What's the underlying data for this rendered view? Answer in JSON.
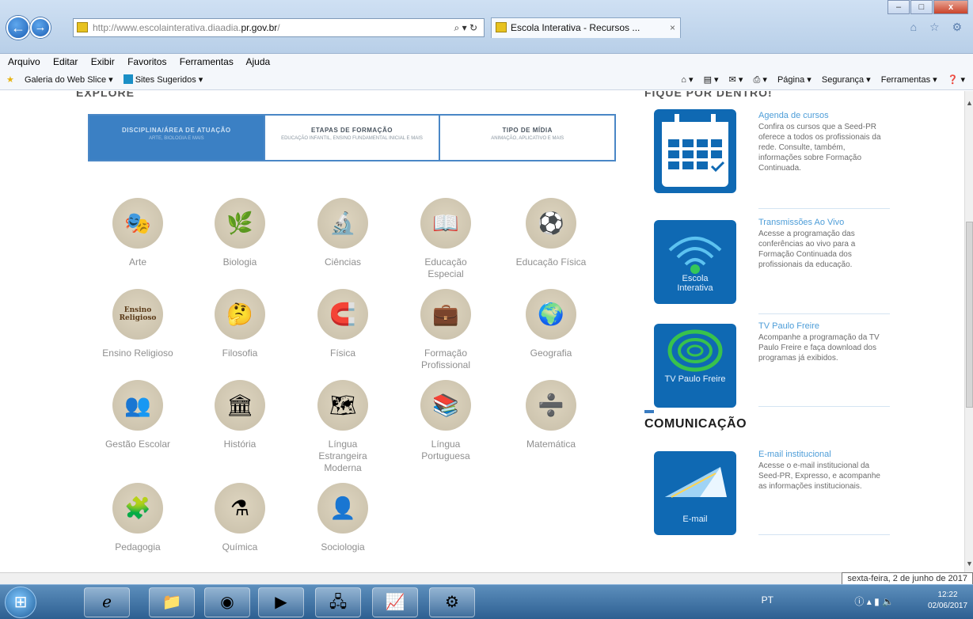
{
  "browser": {
    "url_prefix": "http://www.escolainterativa.diaadia.",
    "url_host": "pr.gov.br",
    "url_suffix": "/",
    "search_controls": "⌕ ▾ ↻",
    "tab_title": "Escola Interativa - Recursos ...",
    "tab_close": "×",
    "back_glyph": "←",
    "forward_glyph": "→",
    "top_icons": "⌂ ☆ ⚙",
    "win_min": "–",
    "win_max": "□",
    "win_close": "x"
  },
  "menu": [
    "Arquivo",
    "Editar",
    "Exibir",
    "Favoritos",
    "Ferramentas",
    "Ajuda"
  ],
  "favorites_bar": {
    "web_slice": "Galeria do Web Slice ▾",
    "suggested": "Sites Sugeridos ▾",
    "right_items": [
      "⌂ ▾",
      "▤ ▾",
      "✉ ▾",
      "⎙ ▾",
      "Página ▾",
      "Segurança ▾",
      "Ferramentas ▾",
      "❓ ▾"
    ]
  },
  "page": {
    "heading_left": "EXPLORE",
    "heading_right": "FIQUE POR DENTRO!",
    "filter_tabs": [
      {
        "title": "DISCIPLINA/ÁREA DE ATUAÇÃO",
        "sub": "ARTE, BIOLOGIA E MAIS"
      },
      {
        "title": "ETAPAS DE FORMAÇÃO",
        "sub": "EDUCAÇÃO INFANTIL, ENSINO FUNDAMENTAL INICIAL E MAIS"
      },
      {
        "title": "TIPO DE MÍDIA",
        "sub": "ANIMAÇÃO, APLICATIVO E MAIS"
      }
    ],
    "subjects": [
      {
        "label": "Arte",
        "icon": "🎭"
      },
      {
        "label": "Biologia",
        "icon": "🌿"
      },
      {
        "label": "Ciências",
        "icon": "🔬"
      },
      {
        "label": "Educação Especial",
        "icon": "📖"
      },
      {
        "label": "Educação Física",
        "icon": "⚽"
      },
      {
        "label": "Ensino Religioso",
        "icon": "Ensino Religioso"
      },
      {
        "label": "Filosofia",
        "icon": "🤔"
      },
      {
        "label": "Física",
        "icon": "🧲"
      },
      {
        "label": "Formação Profissional",
        "icon": "💼"
      },
      {
        "label": "Geografia",
        "icon": "🌍"
      },
      {
        "label": "Gestão Escolar",
        "icon": "👥"
      },
      {
        "label": "História",
        "icon": "🏛"
      },
      {
        "label": "Língua Estrangeira Moderna",
        "icon": "🗺"
      },
      {
        "label": "Língua Portuguesa",
        "icon": "📚"
      },
      {
        "label": "Matemática",
        "icon": "➗"
      },
      {
        "label": "Pedagogia",
        "icon": "🧩"
      },
      {
        "label": "Química",
        "icon": "⚗"
      },
      {
        "label": "Sociologia",
        "icon": "👤"
      }
    ],
    "sidebar": [
      {
        "card_label": "",
        "title": "Agenda de cursos",
        "text": "Confira os cursos que a Seed-PR oferece a todos os profissionais da rede. Consulte, também, informações sobre Formação Continuada."
      },
      {
        "card_label": "Escola Interativa",
        "title": "Transmissões Ao Vivo",
        "text": "Acesse a programação das conferências ao vivo para a Formação Continuada dos profissionais da educação."
      },
      {
        "card_label": "TV Paulo Freire",
        "title": "TV Paulo Freire",
        "text": "Acompanhe a programação da TV Paulo Freire e faça download dos programas já exibidos."
      }
    ],
    "communication_heading": "COMUNICAÇÃO",
    "communication": {
      "card_label": "E-mail",
      "title": "E-mail institucional",
      "text": "Acesse o e-mail institucional da Seed-PR, Expresso, e acompanhe as informações institucionais."
    }
  },
  "status": {
    "date_tooltip": "sexta-feira, 2 de junho de 2017"
  },
  "taskbar": {
    "start_glyph": "⊞",
    "apps": [
      "ℯ",
      "📁",
      "◉",
      "▶",
      "🖧",
      "📈",
      "⚙"
    ],
    "lang": "PT",
    "tray": "ⓘ ▴ ▮ 🔈",
    "time": "12:22",
    "date": "02/06/2017"
  },
  "colors": {
    "accent": "#3b80c4",
    "card_blue": "#0f69b3",
    "link_blue": "#4d9dd8"
  }
}
